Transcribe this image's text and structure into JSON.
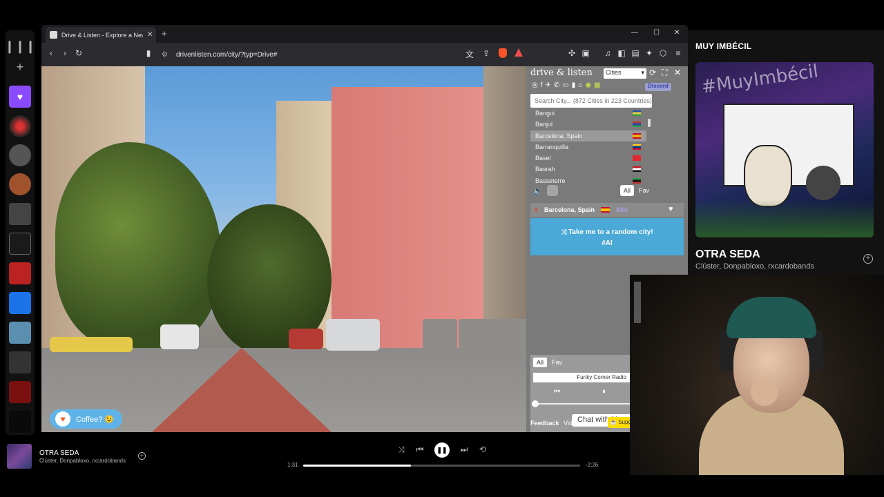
{
  "browser": {
    "tab_title": "Drive & Listen - Explore a New C",
    "url": "drivenlisten.com/city/?typ=Drive#"
  },
  "spotify": {
    "now_playing": {
      "header": "MUY IMBÉCIL",
      "cover_text": "#MuyImbécil",
      "title": "OTRA SEDA",
      "artist": "Clúster, Donpabloxo, rxcardobands"
    },
    "player": {
      "title": "OTRA SEDA",
      "artist": "Clúster, Donpabloxo, rxcardobands",
      "elapsed": "1:31",
      "remaining": "-2:26",
      "progress": 0.39
    }
  },
  "drive": {
    "logo": "drive & listen",
    "mode_select": "Cities",
    "discord_label": "Discord",
    "search_placeholder": "Search City... (872 Cities in 223 Countries)",
    "cities": [
      {
        "name": "Bangui",
        "flag": [
          "#1e4fa8",
          "#e8d33a",
          "#2e9a4a"
        ]
      },
      {
        "name": "Banjul",
        "flag": [
          "#c0332d",
          "#1e4fa8",
          "#2e9a4a"
        ]
      },
      {
        "name": "Barcelona, Spain",
        "flag": [
          "#c8102e",
          "#f6c400",
          "#c8102e"
        ]
      },
      {
        "name": "Barranquilla",
        "flag": [
          "#fcd116",
          "#003893",
          "#ce1126"
        ]
      },
      {
        "name": "Basel",
        "flag": [
          "#e3262f",
          "#e3262f",
          "#e3262f"
        ]
      },
      {
        "name": "Basrah",
        "flag": [
          "#ce1126",
          "#ffffff",
          "#111111"
        ]
      },
      {
        "name": "Basseterre",
        "flag": [
          "#2e9a4a",
          "#111111",
          "#c0332d"
        ]
      }
    ],
    "filter_all": "All",
    "filter_fav": "Fav",
    "current_city": "Barcelona, Spain",
    "wiki_label": "Wiki",
    "random_line1": "Take me to a random city!",
    "random_line2": "#AI",
    "radio": {
      "tab_all": "All",
      "tab_fav": "Fav",
      "station": "Funky Corner Radio",
      "chat": "Chat with Maya"
    },
    "feedback": "Feedback",
    "video_source": "Video Source",
    "support": "Support"
  },
  "coffee_label": "Coffee? 😉"
}
